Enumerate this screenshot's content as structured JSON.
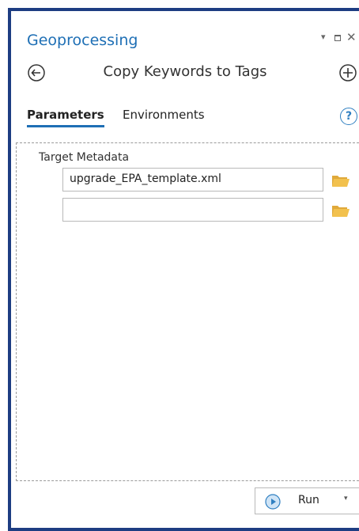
{
  "pane": {
    "title": "Geoprocessing",
    "controls": {
      "pin": "▾",
      "maximize": "maximize-icon",
      "close": "✕"
    }
  },
  "tool": {
    "title": "Copy Keywords to Tags",
    "back_icon": "back-arrow-icon",
    "add_icon": "add-icon"
  },
  "tabs": {
    "parameters": "Parameters",
    "environments": "Environments",
    "help": "?"
  },
  "params": {
    "label": "Target Metadata",
    "inputs": [
      {
        "value": "upgrade_EPA_template.xml"
      },
      {
        "value": ""
      }
    ]
  },
  "run": {
    "label": "Run",
    "dropdown": "▾"
  },
  "colors": {
    "frame": "#1d3d82",
    "accent": "#1e6fb5",
    "folder": "#f2c14e"
  }
}
